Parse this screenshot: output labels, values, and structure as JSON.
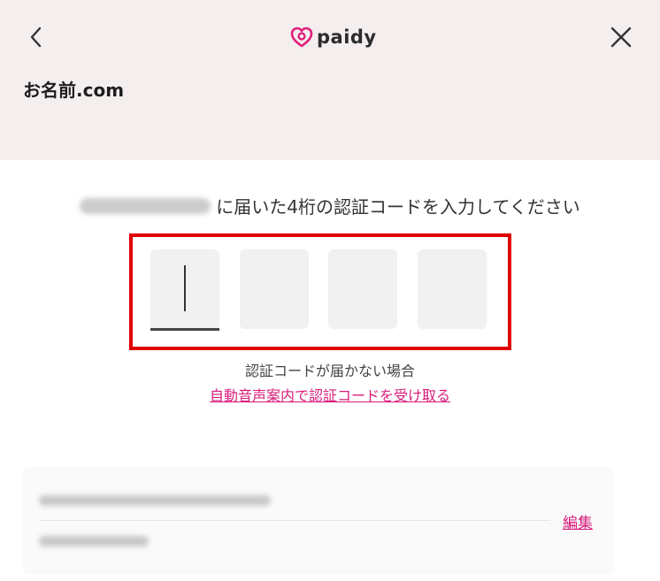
{
  "header": {
    "logo_text": "paidy",
    "merchant_name": "お名前.com",
    "icons": {
      "back": "chevron-left-icon",
      "close": "close-icon",
      "logo": "paidy-heart-icon"
    },
    "colors": {
      "background": "#f4eeee",
      "logo_pink": "#e0207e"
    }
  },
  "verification": {
    "instruction": "に届いた4桁の認証コードを入力してください",
    "code_boxes": [
      "",
      "",
      "",
      ""
    ],
    "no_code_text": "認証コードが届かない場合",
    "voice_link": "自動音声案内で認証コードを受け取る",
    "highlight_color": "#e00000",
    "link_color": "#d81b7a"
  },
  "account": {
    "edit_label": "編集"
  }
}
